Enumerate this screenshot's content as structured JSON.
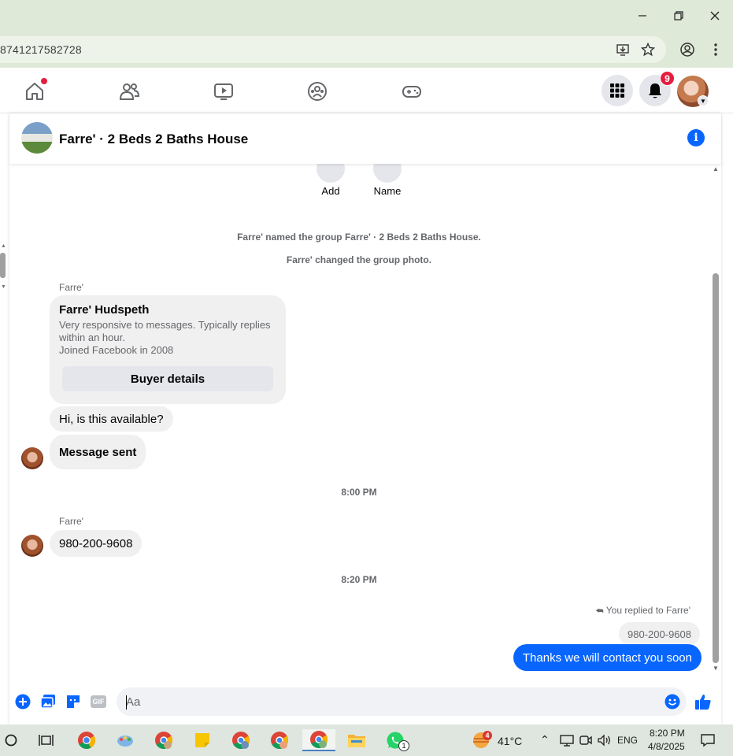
{
  "browser": {
    "url_fragment": "8741217582728",
    "minimize_icon": "minimize-icon",
    "restore_icon": "restore-icon",
    "close_icon": "close-icon"
  },
  "facebook_nav": {
    "icons": [
      "home-icon",
      "friends-icon",
      "video-icon",
      "groups-icon",
      "gaming-icon"
    ],
    "notification_count": "9"
  },
  "chat": {
    "title": "Farre' · 2 Beds 2 Baths House",
    "actions": {
      "add_label": "Add",
      "name_label": "Name"
    },
    "system_messages": {
      "named": "Farre' named the group Farre' · 2 Beds 2 Baths House.",
      "changed_photo": "Farre' changed the group photo."
    },
    "first_sender": "Farre'",
    "profile_card": {
      "name": "Farre' Hudspeth",
      "description": "Very responsive to messages. Typically replies within an hour.",
      "joined": "Joined Facebook in 2008",
      "button": "Buyer details"
    },
    "msg_available": "Hi, is this available?",
    "msg_sent": "Message sent",
    "time_1": "8:00 PM",
    "second_sender": "Farre'",
    "msg_phone": "980-200-9608",
    "time_2": "8:20 PM",
    "reply_label": "You replied to Farre'",
    "quoted": "980-200-9608",
    "my_message": "Thanks we will contact you soon",
    "input_placeholder": "Aa",
    "accent_color": "#0866ff"
  },
  "taskbar": {
    "weather_badge": "4",
    "temperature": "41°C",
    "language": "ENG",
    "time": "8:20 PM",
    "date": "4/8/2025",
    "whatsapp_badge": "1"
  }
}
